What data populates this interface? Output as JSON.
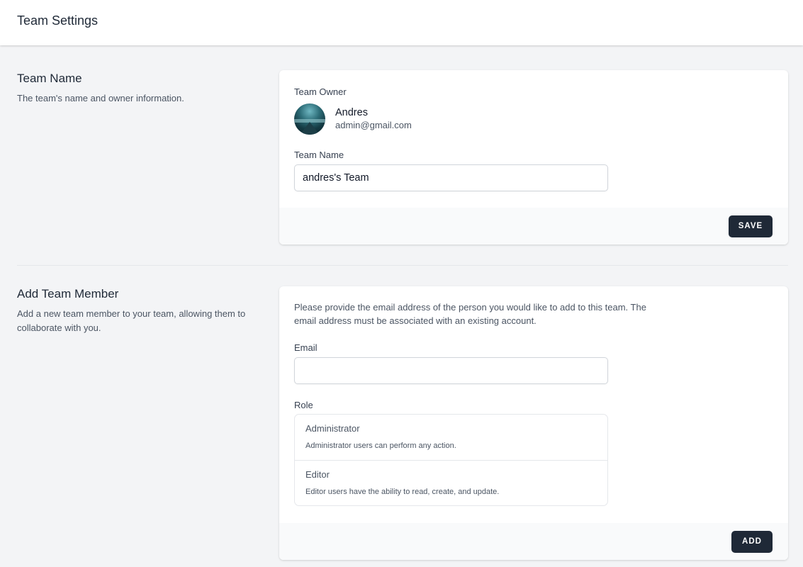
{
  "header": {
    "title": "Team Settings"
  },
  "team_name_section": {
    "title": "Team Name",
    "description": "The team's name and owner information.",
    "owner_label": "Team Owner",
    "owner": {
      "name": "Andres",
      "email": "admin@gmail.com",
      "avatar_icon": "avatar-image"
    },
    "team_name_label": "Team Name",
    "team_name_value": "andres's Team",
    "save_label": "SAVE"
  },
  "add_member_section": {
    "title": "Add Team Member",
    "description": "Add a new team member to your team, allowing them to collaborate with you.",
    "intro": "Please provide the email address of the person you would like to add to this team. The email address must be associated with an existing account.",
    "email_label": "Email",
    "email_value": "",
    "role_label": "Role",
    "roles": [
      {
        "name": "Administrator",
        "description": "Administrator users can perform any action."
      },
      {
        "name": "Editor",
        "description": "Editor users have the ability to read, create, and update."
      }
    ],
    "add_label": "ADD"
  }
}
